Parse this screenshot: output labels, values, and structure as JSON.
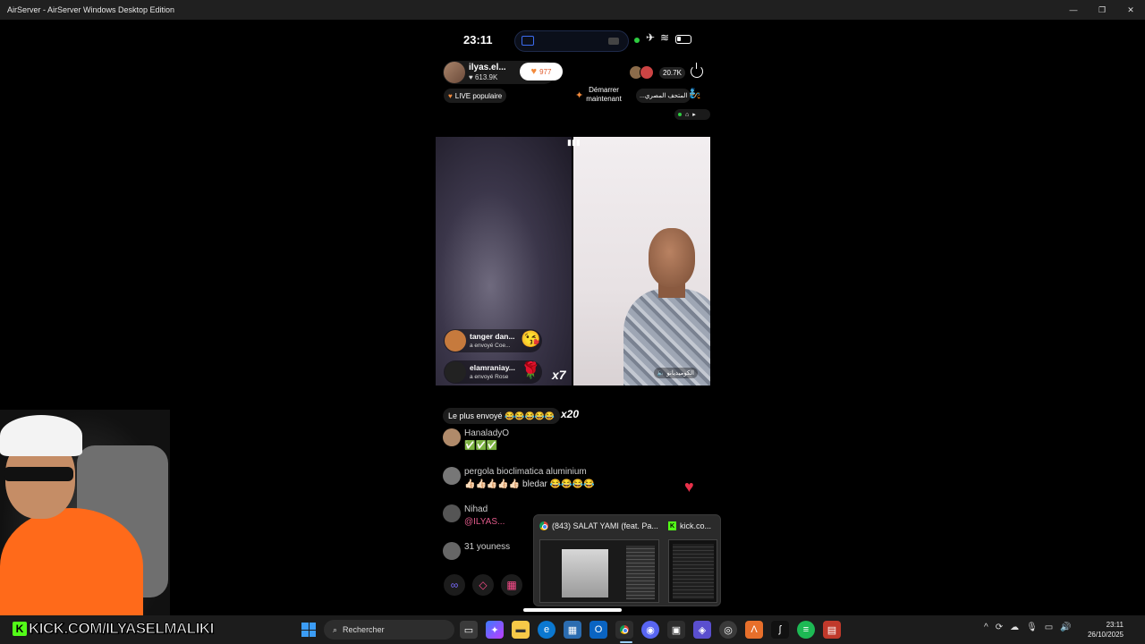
{
  "window": {
    "title": "AirServer - AirServer Windows Desktop Edition",
    "controls": {
      "minimize": "—",
      "maximize": "❐",
      "close": "✕"
    }
  },
  "phone": {
    "time": "23:11",
    "host": {
      "name": "ilyas.el...",
      "likes": "♥ 613.9K",
      "follow_count": "977"
    },
    "viewer_count": "20.7K",
    "live_popular": "LIVE populaire",
    "start_now": [
      "Démarrer",
      "maintenant"
    ],
    "arabic_badge": "...المتحف المصري",
    "right_video_label": "الكوميديانو",
    "gifts": [
      {
        "name": "tanger dan...",
        "sub": "a envoyé  Coe...",
        "emoji": "😘"
      },
      {
        "name": "elamraniay...",
        "sub": "a envoyé  Rose",
        "emoji": "🌹"
      }
    ],
    "gift_multiplier": "x7",
    "most_sent": "Le plus envoyé 😂😂😂😂😂",
    "most_sent_multiplier": "x20",
    "comments": [
      {
        "name": "HanaladyO",
        "text": "✅✅✅"
      },
      {
        "name": "pergola bioclimatica aluminium",
        "text": "👍🏻👍🏻👍🏻👍🏻👍🏻 bledar 😂😂😂😂"
      },
      {
        "name": "Nihad",
        "text": "@ILYAS..."
      },
      {
        "name": "31  youness",
        "text": ""
      }
    ]
  },
  "popup": {
    "tab1_title": "(843) SALAT YAMI (feat. Pa...",
    "tab2_title": "kick.co..."
  },
  "overlay": {
    "kick_text": "KICK.COM/ILYASELMALIKI"
  },
  "taskbar": {
    "search_placeholder": "Rechercher",
    "clock_time": "23:11",
    "clock_date": "26/10/2025"
  },
  "colors": {
    "kick_green": "#53fc18",
    "accent_orange": "#f28a3c",
    "heart_red": "#e8314a"
  }
}
